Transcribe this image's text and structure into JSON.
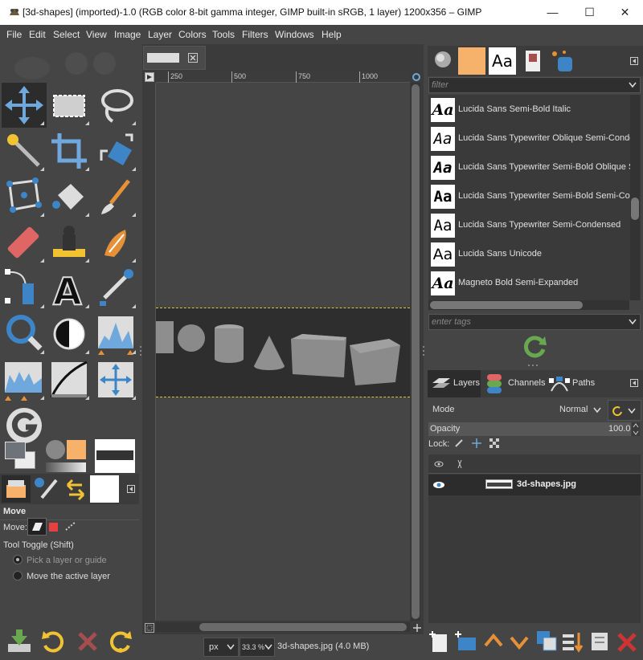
{
  "window": {
    "title": "[3d-shapes] (imported)-1.0 (RGB color 8-bit gamma integer, GIMP built-in sRGB, 1 layer) 1200x356 – GIMP",
    "minimize": "—",
    "maximize": "☐",
    "close": "✕"
  },
  "menu": [
    "File",
    "Edit",
    "Select",
    "View",
    "Image",
    "Layer",
    "Colors",
    "Tools",
    "Filters",
    "Windows",
    "Help"
  ],
  "tool_options": {
    "title": "Move",
    "move_label": "Move:",
    "toggle_label": "Tool Toggle  (Shift)",
    "option_pick": "Pick a layer or guide",
    "option_move_active": "Move the active layer"
  },
  "ruler": {
    "ticks": [
      "250",
      "500",
      "750",
      "1000"
    ]
  },
  "status": {
    "unit": "px",
    "zoom": "33.3 %",
    "file_info": "3d-shapes.jpg (4.0 MB)"
  },
  "fonts_panel": {
    "filter_placeholder": "filter",
    "preview_glyph": "Aa",
    "items": [
      "Lucida Sans Semi-Bold Italic",
      "Lucida Sans Typewriter Oblique Semi-Conden",
      "Lucida Sans Typewriter Semi-Bold Oblique Se",
      "Lucida Sans Typewriter Semi-Bold Semi-Cond",
      "Lucida Sans Typewriter Semi-Condensed",
      "Lucida Sans Unicode",
      "Magneto Bold Semi-Expanded"
    ],
    "tags_placeholder": "enter tags"
  },
  "layers_panel": {
    "tabs": [
      "Layers",
      "Channels",
      "Paths"
    ],
    "mode_label": "Mode",
    "mode_value": "Normal",
    "opacity_label": "Opacity",
    "opacity_value": "100.0",
    "lock_label": "Lock:",
    "layer_name": "3d-shapes.jpg"
  },
  "colors": {
    "accent_selection": "#d4c84a",
    "fg_color": "#6d7378",
    "bg_color": "#ececec"
  }
}
